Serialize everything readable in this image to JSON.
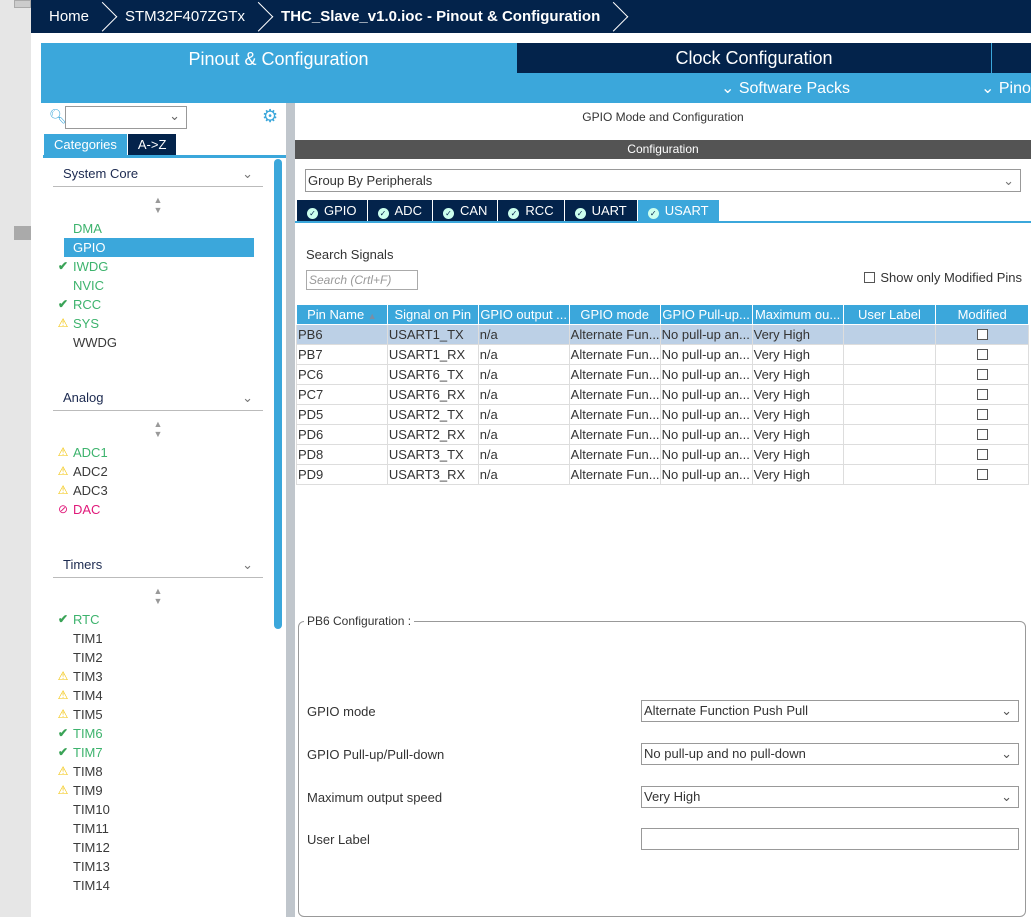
{
  "breadcrumb": [
    "Home",
    "STM32F407ZGTx",
    "THC_Slave_v1.0.ioc - Pinout & Configuration"
  ],
  "tabs": {
    "pinout": "Pinout & Configuration",
    "clock": "Clock Configuration",
    "software_packs": "Software Packs",
    "pinout_short": "Pino"
  },
  "sidebar": {
    "search_value": "",
    "tab_categories": "Categories",
    "tab_az": "A->Z",
    "groups": [
      {
        "title": "System Core",
        "items": [
          {
            "label": "DMA",
            "status": "none",
            "color": "green"
          },
          {
            "label": "GPIO",
            "status": "none",
            "color": "selected"
          },
          {
            "label": "IWDG",
            "status": "check",
            "color": "green"
          },
          {
            "label": "NVIC",
            "status": "none",
            "color": "green"
          },
          {
            "label": "RCC",
            "status": "check",
            "color": "green"
          },
          {
            "label": "SYS",
            "status": "warning",
            "color": "green"
          },
          {
            "label": "WWDG",
            "status": "none",
            "color": "dark"
          }
        ]
      },
      {
        "title": "Analog",
        "items": [
          {
            "label": "ADC1",
            "status": "warning",
            "color": "green"
          },
          {
            "label": "ADC2",
            "status": "warning",
            "color": "dark"
          },
          {
            "label": "ADC3",
            "status": "warning",
            "color": "dark"
          },
          {
            "label": "DAC",
            "status": "ban",
            "color": "pink"
          }
        ]
      },
      {
        "title": "Timers",
        "items": [
          {
            "label": "RTC",
            "status": "check",
            "color": "green"
          },
          {
            "label": "TIM1",
            "status": "none",
            "color": "dark"
          },
          {
            "label": "TIM2",
            "status": "none",
            "color": "dark"
          },
          {
            "label": "TIM3",
            "status": "warning",
            "color": "dark"
          },
          {
            "label": "TIM4",
            "status": "warning",
            "color": "dark"
          },
          {
            "label": "TIM5",
            "status": "warning",
            "color": "dark"
          },
          {
            "label": "TIM6",
            "status": "check",
            "color": "green"
          },
          {
            "label": "TIM7",
            "status": "check",
            "color": "green"
          },
          {
            "label": "TIM8",
            "status": "warning",
            "color": "dark"
          },
          {
            "label": "TIM9",
            "status": "warning",
            "color": "dark"
          },
          {
            "label": "TIM10",
            "status": "none",
            "color": "dark"
          },
          {
            "label": "TIM11",
            "status": "none",
            "color": "dark"
          },
          {
            "label": "TIM12",
            "status": "none",
            "color": "dark"
          },
          {
            "label": "TIM13",
            "status": "none",
            "color": "dark"
          },
          {
            "label": "TIM14",
            "status": "none",
            "color": "dark"
          }
        ]
      }
    ]
  },
  "main": {
    "title": "GPIO Mode and Configuration",
    "config_bar": "Configuration",
    "group_by": "Group By Peripherals",
    "periph_tabs": [
      "GPIO",
      "ADC",
      "CAN",
      "RCC",
      "UART",
      "USART"
    ],
    "active_tab": "USART",
    "search_label": "Search Signals",
    "search_placeholder": "Search (Crtl+F)",
    "show_modified": "Show only Modified Pins",
    "columns": [
      "Pin Name",
      "Signal on Pin",
      "GPIO output ...",
      "GPIO mode",
      "GPIO Pull-up...",
      "Maximum ou...",
      "User Label",
      "Modified"
    ],
    "rows": [
      [
        "PB6",
        "USART1_TX",
        "n/a",
        "Alternate Fun...",
        "No pull-up an...",
        "Very High",
        ""
      ],
      [
        "PB7",
        "USART1_RX",
        "n/a",
        "Alternate Fun...",
        "No pull-up an...",
        "Very High",
        ""
      ],
      [
        "PC6",
        "USART6_TX",
        "n/a",
        "Alternate Fun...",
        "No pull-up an...",
        "Very High",
        ""
      ],
      [
        "PC7",
        "USART6_RX",
        "n/a",
        "Alternate Fun...",
        "No pull-up an...",
        "Very High",
        ""
      ],
      [
        "PD5",
        "USART2_TX",
        "n/a",
        "Alternate Fun...",
        "No pull-up an...",
        "Very High",
        ""
      ],
      [
        "PD6",
        "USART2_RX",
        "n/a",
        "Alternate Fun...",
        "No pull-up an...",
        "Very High",
        ""
      ],
      [
        "PD8",
        "USART3_TX",
        "n/a",
        "Alternate Fun...",
        "No pull-up an...",
        "Very High",
        ""
      ],
      [
        "PD9",
        "USART3_RX",
        "n/a",
        "Alternate Fun...",
        "No pull-up an...",
        "Very High",
        ""
      ]
    ],
    "pin_config": {
      "title": "PB6 Configuration :",
      "fields": [
        {
          "label": "GPIO mode",
          "value": "Alternate Function Push Pull"
        },
        {
          "label": "GPIO Pull-up/Pull-down",
          "value": "No pull-up and no pull-down"
        },
        {
          "label": "Maximum output speed",
          "value": "Very High"
        },
        {
          "label": "User Label",
          "value": ""
        }
      ]
    }
  },
  "colors": {
    "navy": "#03234b",
    "accent": "#3ba7db",
    "green": "#3db36d",
    "warning": "#f2c200",
    "error": "#e0197a"
  }
}
